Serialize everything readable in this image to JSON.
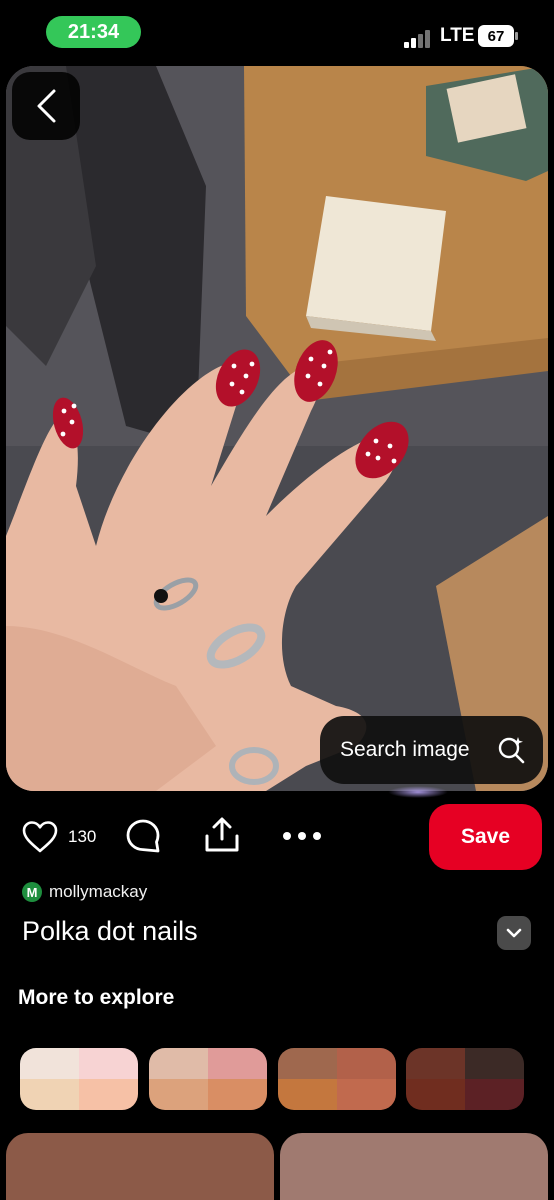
{
  "status_bar": {
    "time": "21:34",
    "network": "LTE",
    "battery": "67"
  },
  "pin": {
    "search_image_label": "Search image",
    "like_count": "130",
    "save_label": "Save",
    "author_initial": "M",
    "author": "mollymackay",
    "title": "Polka dot nails"
  },
  "explore": {
    "section_title": "More to explore",
    "swatches": [
      {
        "colors": [
          "#f1e3da",
          "#f7d3d3",
          "#f0d3b4",
          "#f6c1a6"
        ]
      },
      {
        "colors": [
          "#e0bba8",
          "#e09b99",
          "#dca27c",
          "#d98e64"
        ]
      },
      {
        "colors": [
          "#9f684e",
          "#b2614a",
          "#c4773e",
          "#c16a4e"
        ]
      },
      {
        "colors": [
          "#6c3428",
          "#3c2a26",
          "#702d1f",
          "#5c2125"
        ]
      }
    ],
    "cards": [
      {
        "color": "#8c5a48"
      },
      {
        "color": "#a07a70"
      }
    ]
  },
  "colors": {
    "accent": "#e60023",
    "status_green": "#34c759",
    "background": "#000000"
  },
  "icons": [
    "back-icon",
    "search-image-icon",
    "heart-icon",
    "comment-icon",
    "share-icon",
    "more-icon",
    "chevron-down-icon"
  ]
}
